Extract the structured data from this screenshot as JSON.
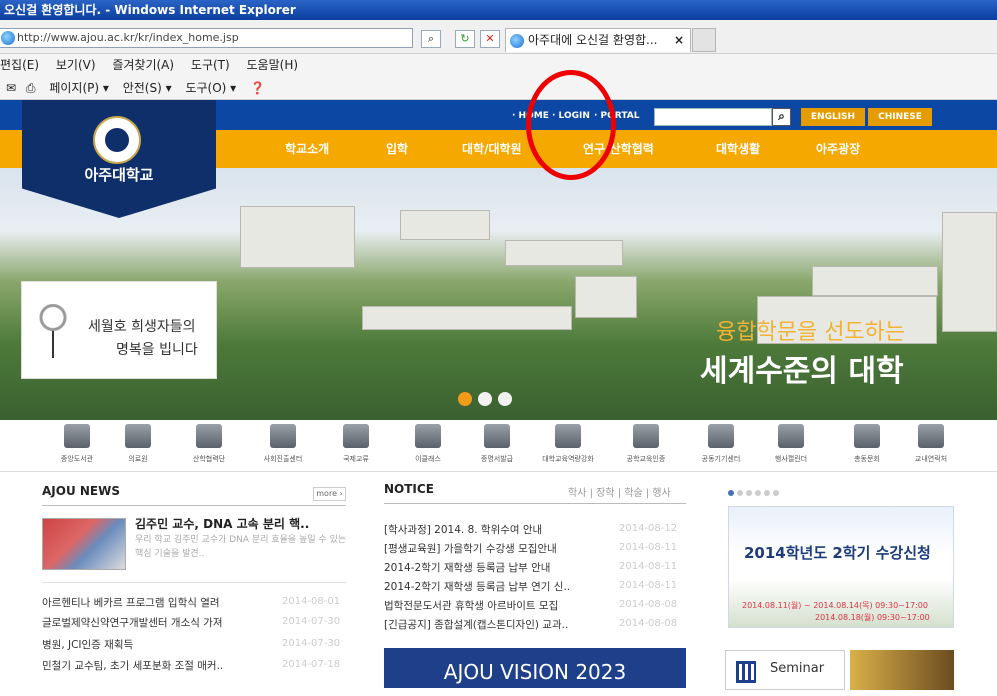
{
  "browser": {
    "title": "오신걸 환영합니다. - Windows Internet Explorer",
    "url": "http://www.ajou.ac.kr/kr/index_home.jsp",
    "tab_label": "아주대에 오신걸 환영합...",
    "tab_close": "×",
    "menu": [
      "편집(E)",
      "보기(V)",
      "즐겨찾기(A)",
      "도구(T)",
      "도움말(H)"
    ],
    "commands": [
      "페이지(P) ▾",
      "안전(S) ▾",
      "도구(O) ▾"
    ]
  },
  "site": {
    "top_links": [
      "· HOME",
      "· LOGIN",
      "· PORTAL"
    ],
    "lang_buttons": [
      "ENGLISH",
      "CHINESE"
    ],
    "logo_text": "아주대학교",
    "nav": [
      "학교소개",
      "입학",
      "대학/대학원",
      "연구·산학협력",
      "대학생활",
      "아주광장"
    ],
    "hero": {
      "memorial_line1": "세월호 희생자들의",
      "memorial_line2": "명복을 빕니다",
      "slogan_line1": "융합학문을 선도하는",
      "slogan_line2": "세계수준의 대학"
    },
    "quick_links": [
      "중앙도서관",
      "의료원",
      "산학협력단",
      "사회진출센터",
      "국제교류",
      "이클래스",
      "증명서발급",
      "대학교육역량강화",
      "공학교육인증",
      "공동기기센터",
      "행사캘린더",
      "총동문회",
      "교내연락처"
    ],
    "news": {
      "title": "AJOU NEWS",
      "more": "more ›",
      "featured_title": "김주민 교수, DNA 고속 분리 핵..",
      "featured_desc": "우리 학교 김주민 교수가 DNA 분리 효율을 높일 수 있는 핵심 기술을 발견..",
      "items": [
        {
          "title": "아르헨티나 베카르 프로그램 입학식 열려",
          "date": "2014-08-01"
        },
        {
          "title": "글로벌제약신약연구개발센터 개소식 가져",
          "date": "2014-07-30"
        },
        {
          "title": "병원, JCI인증 재획득",
          "date": "2014-07-30"
        },
        {
          "title": "민철기 교수팀, 초기 세포분화 조절 매커..",
          "date": "2014-07-18"
        }
      ]
    },
    "notice": {
      "title": "NOTICE",
      "tabs": "학사 | 장학 | 학술 | 행사",
      "items": [
        {
          "title": "[학사과정] 2014. 8. 학위수여 안내",
          "date": "2014-08-12"
        },
        {
          "title": "[평생교육원] 가을학기 수강생 모집안내",
          "date": "2014-08-11"
        },
        {
          "title": "2014-2학기 재학생 등록금 납부 안내",
          "date": "2014-08-11"
        },
        {
          "title": "2014-2학기 재학생 등록금 납부 연기 신..",
          "date": "2014-08-11"
        },
        {
          "title": "법학전문도서관 휴학생 아르바이트 모집",
          "date": "2014-08-08"
        },
        {
          "title": "[긴급공지] 종합설계(캡스톤디자인) 교과..",
          "date": "2014-08-08"
        }
      ],
      "vision_banner": "AJOU VISION 2023"
    },
    "side": {
      "reg_title": "2014학년도 2학기 수강신청",
      "reg_line1": "2014.08.11(월) ~ 2014.08.14(목) 09:30~17:00",
      "reg_line2": "2014.08.18(월) 09:30~17:00",
      "seminar": "Seminar"
    }
  }
}
